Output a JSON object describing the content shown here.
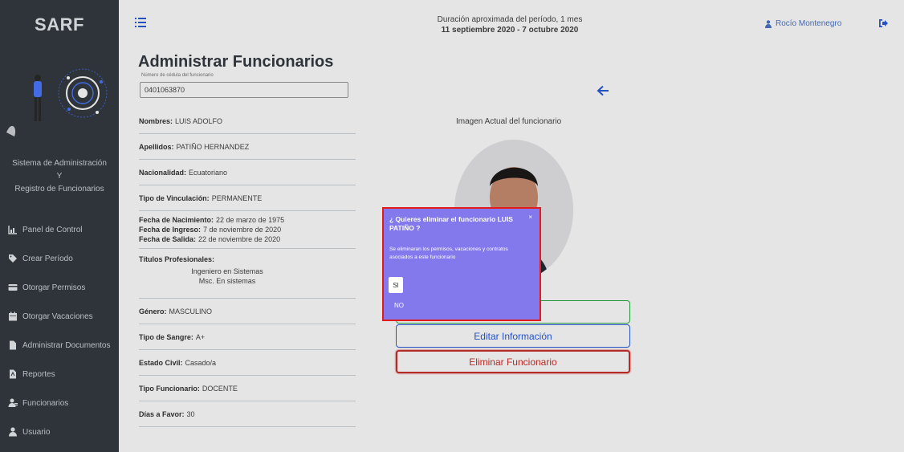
{
  "sidebar": {
    "brand": "SARF",
    "system_title_1": "Sistema de Administración",
    "system_title_2": "Y",
    "system_title_3": "Registro de Funcionarios",
    "items": [
      {
        "label": "Panel de Control",
        "icon": "chart-icon"
      },
      {
        "label": "Crear Período",
        "icon": "tags-icon"
      },
      {
        "label": "Otorgar Permisos",
        "icon": "card-icon"
      },
      {
        "label": "Otorgar Vacaciones",
        "icon": "calendar-icon"
      },
      {
        "label": "Administrar Documentos",
        "icon": "file-icon"
      },
      {
        "label": "Reportes",
        "icon": "pdf-icon"
      },
      {
        "label": "Funcionarios",
        "icon": "users-icon"
      },
      {
        "label": "Usuario",
        "icon": "user-icon"
      }
    ]
  },
  "topbar": {
    "period_line": "Duración aproximada del período, 1 mes",
    "period_dates": "11 septiembre 2020 - 7 octubre 2020",
    "user_name": "Rocío Montenegro"
  },
  "main": {
    "title": "Administrar Funcionarios",
    "cedula_label": "Número de cédula del funcionario",
    "cedula_value": "0401063870",
    "image_caption": "Imagen Actual del funcionario",
    "fields": {
      "nombres_label": "Nombres:",
      "nombres": "LUIS ADOLFO",
      "apellidos_label": "Apellidos:",
      "apellidos": "PATIÑO HERNANDEZ",
      "nacionalidad_label": "Nacionalidad:",
      "nacionalidad": "Ecuatoriano",
      "vinculacion_label": "Tipo de Vinculación:",
      "vinculacion": "PERMANENTE",
      "nacimiento_label": "Fecha de Nacimiento:",
      "nacimiento": "22 de marzo de 1975",
      "ingreso_label": "Fecha de Ingreso:",
      "ingreso": "7 de noviembre de 2020",
      "salida_label": "Fecha de Salida:",
      "salida": "22 de noviembre de 2020",
      "titulos_label": "Títulos Profesionales:",
      "titulo_1": "Ingeniero en Sistemas",
      "titulo_2": "Msc. En sistemas",
      "genero_label": "Género:",
      "genero": "MASCULINO",
      "sangre_label": "Tipo de Sangre:",
      "sangre": "A+",
      "civil_label": "Estado Civil:",
      "civil": "Casado/a",
      "tipo_label": "Tipo Funcionario:",
      "tipo": "DOCENTE",
      "dias_label": "Días a Favor:",
      "dias": "30"
    },
    "buttons": {
      "green_visible": "ación",
      "edit": "Editar Información",
      "delete": "Eliminar Funcionario"
    }
  },
  "modal": {
    "question": "¿ Quieres eliminar el funcionario LUIS PATIÑO ?",
    "message": "Se eliminaran los permisos, vacaciones y contratos asociados a este funcionario",
    "close": "×",
    "yes": "SI",
    "no": "NO"
  },
  "colors": {
    "sidebar": "#343a40",
    "modal": "#8479ec",
    "highlight": "#e31b1b",
    "danger": "#c9302c",
    "primary": "#2a5bd7",
    "success": "#28a745"
  }
}
